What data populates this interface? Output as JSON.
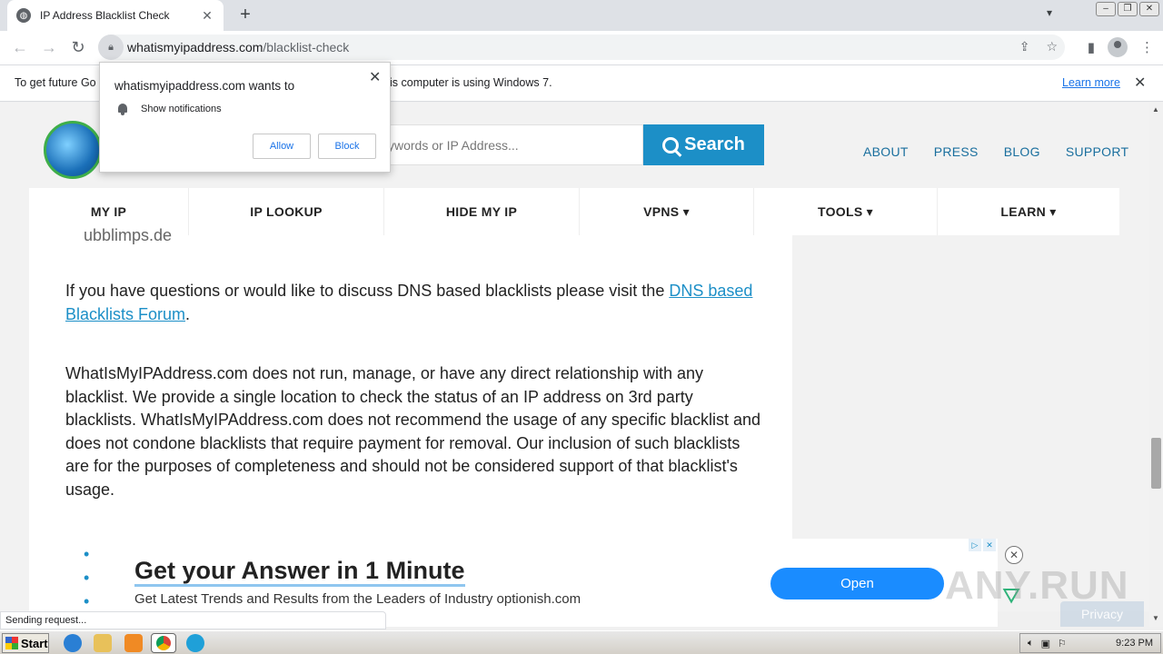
{
  "browser": {
    "tab_title": "IP Address Blacklist Check",
    "tab_close": "✕",
    "new_tab": "+",
    "url_host": "whatismyipaddress.com",
    "url_path": "/blacklist-check"
  },
  "infobar": {
    "message_start": "To get future Go",
    "message_end": "is computer is using Windows 7.",
    "learn_more": "Learn more",
    "close": "✕"
  },
  "popup": {
    "heading": "whatismyipaddress.com wants to",
    "permission": "Show notifications",
    "allow": "Allow",
    "block": "Block",
    "close": "✕"
  },
  "site": {
    "search_placeholder": "ywords or IP Address...",
    "search_button": "Search",
    "top_links": [
      "ABOUT",
      "PRESS",
      "BLOG",
      "SUPPORT"
    ],
    "nav": [
      {
        "label": "MY IP",
        "width": 176
      },
      {
        "label": "IP LOOKUP",
        "width": 215
      },
      {
        "label": "HIDE MY IP",
        "width": 215
      },
      {
        "label": "VPNS ▾",
        "width": 192
      },
      {
        "label": "TOOLS ▾",
        "width": 202
      },
      {
        "label": "LEARN ▾",
        "width": 200
      }
    ]
  },
  "content": {
    "fragment": "ubblimps.de",
    "p1_text": "If you have questions or would like to discuss DNS based blacklists please visit the ",
    "p1_link": "DNS based Blacklists Forum",
    "p1_end": ".",
    "p2": "WhatIsMyIPAddress.com does not run, manage, or have any direct relationship with any blacklist. We provide a single location to check the status of an IP address on 3rd party blacklists. WhatIsMyIPAddress.com does not recommend the usage of any specific blacklist and does not condone blacklists that require payment for removal. Our inclusion of such blacklists are for the purposes of completeness and should not be considered support of that blacklist's usage."
  },
  "ad": {
    "headline": "Get your Answer in 1 Minute",
    "sub": "Get Latest Trends and Results from the Leaders of Industry optionish.com",
    "open": "Open",
    "privacy": "Privacy",
    "watermark": "ANY.RUN"
  },
  "status": "Sending request...",
  "taskbar": {
    "start": "Start",
    "clock": "9:23 PM"
  }
}
